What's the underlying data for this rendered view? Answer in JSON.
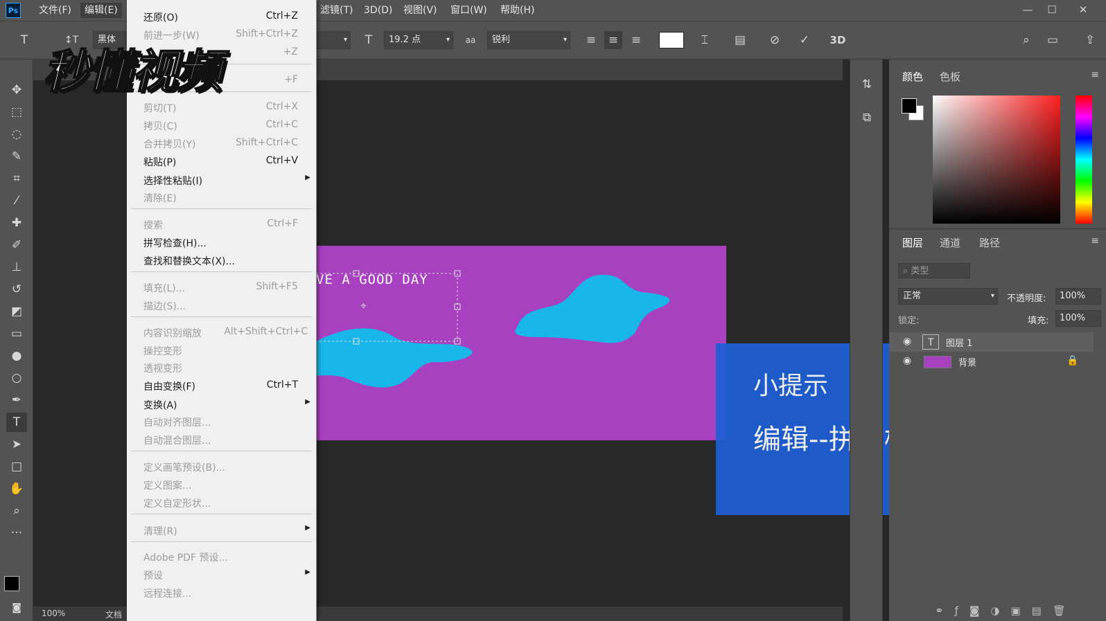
{
  "menubar": {
    "items": [
      "文件(F)",
      "编辑(E)",
      "滤镜(T)",
      "3D(D)",
      "视图(V)",
      "窗口(W)",
      "帮助(H)"
    ],
    "logo": "Ps"
  },
  "options": {
    "font_family": "黑体",
    "font_size": "19.2 点",
    "antialias_icon_text": "aa",
    "antialias": "锐利",
    "three_d": "3D",
    "text_color": "#ffffff"
  },
  "edit_menu": {
    "items": [
      {
        "label": "还原(O)",
        "shortcut": "Ctrl+Z",
        "enabled": true
      },
      {
        "label": "前进一步(W)",
        "shortcut": "Shift+Ctrl+Z",
        "enabled": false
      },
      {
        "label": "",
        "shortcut": "+Z",
        "enabled": false
      },
      {
        "label": "",
        "shortcut": "+F",
        "enabled": false
      },
      {
        "label": "剪切(T)",
        "shortcut": "Ctrl+X",
        "enabled": false
      },
      {
        "label": "拷贝(C)",
        "shortcut": "Ctrl+C",
        "enabled": false
      },
      {
        "label": "合并拷贝(Y)",
        "shortcut": "Shift+Ctrl+C",
        "enabled": false
      },
      {
        "label": "粘贴(P)",
        "shortcut": "Ctrl+V",
        "enabled": true
      },
      {
        "label": "选择性粘贴(I)",
        "shortcut": "",
        "enabled": true,
        "submenu": true
      },
      {
        "label": "清除(E)",
        "shortcut": "",
        "enabled": false
      },
      {
        "label": "搜索",
        "shortcut": "Ctrl+F",
        "enabled": false
      },
      {
        "label": "拼写检查(H)...",
        "shortcut": "",
        "enabled": true
      },
      {
        "label": "查找和替换文本(X)...",
        "shortcut": "",
        "enabled": true
      },
      {
        "label": "填充(L)...",
        "shortcut": "Shift+F5",
        "enabled": false
      },
      {
        "label": "描边(S)...",
        "shortcut": "",
        "enabled": false
      },
      {
        "label": "内容识别缩放",
        "shortcut": "Alt+Shift+Ctrl+C",
        "enabled": false
      },
      {
        "label": "操控变形",
        "shortcut": "",
        "enabled": false
      },
      {
        "label": "透视变形",
        "shortcut": "",
        "enabled": false
      },
      {
        "label": "自由变换(F)",
        "shortcut": "Ctrl+T",
        "enabled": true
      },
      {
        "label": "变换(A)",
        "shortcut": "",
        "enabled": true,
        "submenu": true
      },
      {
        "label": "自动对齐图层...",
        "shortcut": "",
        "enabled": false
      },
      {
        "label": "自动混合图层...",
        "shortcut": "",
        "enabled": false
      },
      {
        "label": "定义画笔预设(B)...",
        "shortcut": "",
        "enabled": false
      },
      {
        "label": "定义图案...",
        "shortcut": "",
        "enabled": false
      },
      {
        "label": "定义自定形状...",
        "shortcut": "",
        "enabled": false
      },
      {
        "label": "清理(R)",
        "shortcut": "",
        "enabled": false,
        "submenu": true
      },
      {
        "label": "Adobe PDF 预设...",
        "shortcut": "",
        "enabled": false
      },
      {
        "label": "预设",
        "shortcut": "",
        "enabled": false,
        "submenu": true
      },
      {
        "label": "远程连接...",
        "shortcut": "",
        "enabled": false
      }
    ]
  },
  "watermark": "秒懂视频",
  "canvas": {
    "text": "VE A GOOD DAY",
    "doc_color": "#a741c0",
    "blob_color": "#19b6ea"
  },
  "hint": {
    "title": "小提示",
    "body": "编辑--拼写检查"
  },
  "color_panel": {
    "tabs": [
      "颜色",
      "色板"
    ],
    "fg_color": "#000000",
    "bg_color": "#ffffff"
  },
  "layers_panel": {
    "tabs": [
      "图层",
      "通道",
      "路径"
    ],
    "filter_placeholder": "类型",
    "blend_mode": "正常",
    "opacity_label": "不透明度:",
    "opacity": "100%",
    "lock_label": "锁定:",
    "fill_label": "填充:",
    "fill": "100%",
    "layers": [
      {
        "name": "图层 1",
        "kind": "text"
      },
      {
        "name": "背景",
        "kind": "fill",
        "locked": true
      }
    ]
  },
  "status": {
    "zoom": "100%",
    "doc_label": "文档"
  }
}
